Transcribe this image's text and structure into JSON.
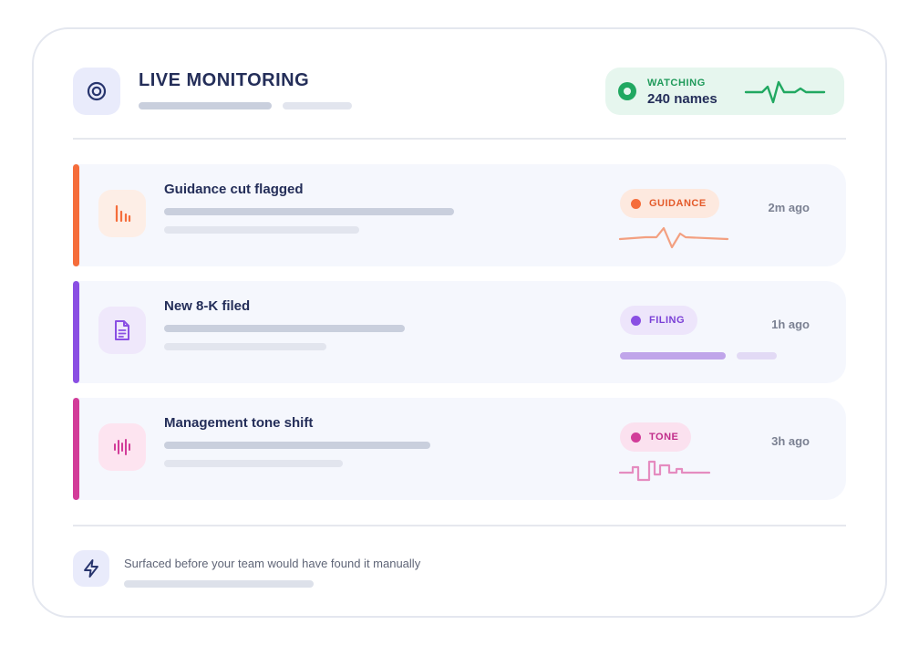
{
  "header": {
    "title": "LIVE MONITORING",
    "icon": "target-icon"
  },
  "watching": {
    "label": "WATCHING",
    "count": "240 names",
    "icon": "radio-dot-icon",
    "color": "#21a861"
  },
  "alerts": [
    {
      "title": "Guidance cut flagged",
      "tag": "GUIDANCE",
      "time": "2m ago",
      "icon": "bar-chart-icon",
      "accent": "#f56d3b",
      "tag_bg": "#fde9df",
      "icon_bg": "#fdeee6",
      "visual": "pulse-line"
    },
    {
      "title": "New 8-K filed",
      "tag": "FILING",
      "time": "1h ago",
      "icon": "document-icon",
      "accent": "#8a4fe3",
      "tag_bg": "#ede5fb",
      "icon_bg": "#efe8fb",
      "visual": "progress-bars"
    },
    {
      "title": "Management tone shift",
      "tag": "TONE",
      "time": "3h ago",
      "icon": "audio-wave-icon",
      "accent": "#d23c99",
      "tag_bg": "#fbe1ef",
      "icon_bg": "#fde4f0",
      "visual": "square-wave"
    }
  ],
  "footer": {
    "text": "Surfaced before your team would have found it manually",
    "icon": "lightning-icon"
  }
}
